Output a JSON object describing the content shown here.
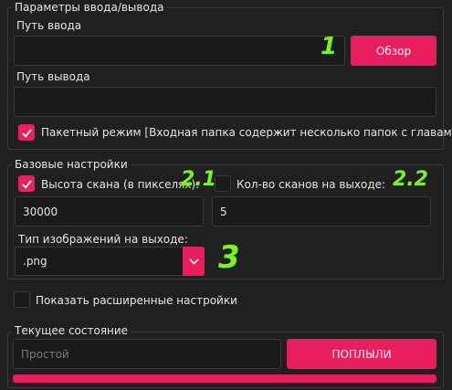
{
  "io_group": {
    "title": "Параметры ввода/вывода",
    "input_label": "Путь ввода",
    "input_value": "",
    "browse_button": "Обзор",
    "output_label": "Путь вывода",
    "output_value": "",
    "batch_mode_label": "Пакетный режим [Входная папка содержит несколько папок с главами]",
    "batch_mode_checked": true
  },
  "basic_group": {
    "title": "Базовые настройки",
    "scan_height_label": "Высота скана (в пикселях):",
    "scan_height_checked": true,
    "scan_height_value": "30000",
    "scan_count_label": "Кол-во сканов на выходе:",
    "scan_count_checked": false,
    "scan_count_value": "5",
    "image_type_label": "Тип изображений на выходе:",
    "image_type_value": ".png"
  },
  "advanced": {
    "label": "Показать расширенные настройки",
    "checked": false
  },
  "status_group": {
    "title": "Текущее состояние",
    "status_placeholder": "Простой",
    "run_button": "ПОПЛЫЛИ",
    "progress": 1.0
  },
  "annotations": {
    "a1": "1",
    "a21": "2.1",
    "a22": "2.2",
    "a3": "3"
  },
  "colors": {
    "accent": "#e91e5f",
    "annotation": "#7cf41b",
    "background": "#202020"
  },
  "icons": {
    "check": "check-icon",
    "dropdown": "chevron-down-icon"
  }
}
